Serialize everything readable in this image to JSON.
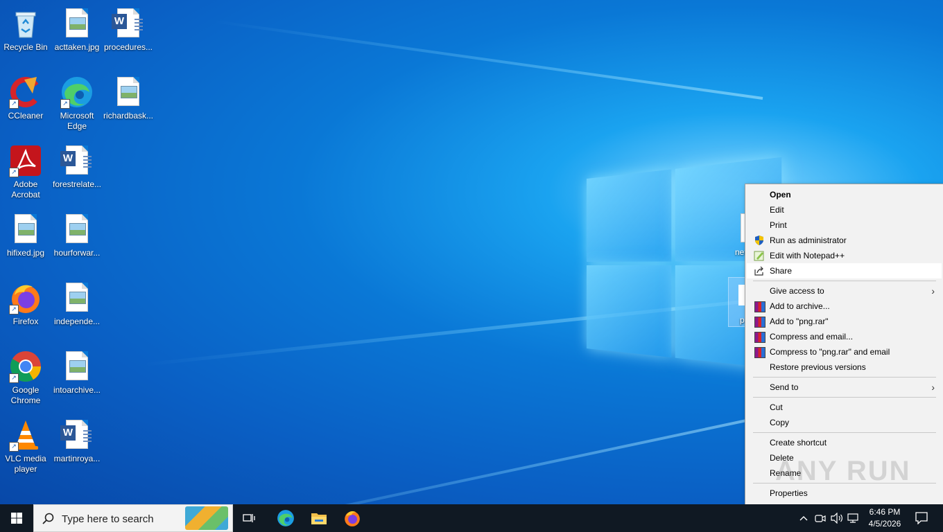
{
  "desktop": {
    "icons": [
      {
        "label": "Recycle Bin",
        "kind": "recycle-bin"
      },
      {
        "label": "acttaken.jpg",
        "kind": "image-file"
      },
      {
        "label": "procedures...",
        "kind": "word-file"
      },
      {
        "label": "CCleaner",
        "kind": "ccleaner"
      },
      {
        "label": "Microsoft Edge",
        "kind": "edge"
      },
      {
        "label": "richardbask...",
        "kind": "image-file"
      },
      {
        "label": "Adobe Acrobat",
        "kind": "acrobat"
      },
      {
        "label": "forestrelate...",
        "kind": "word-file"
      },
      {
        "label": "hifixed.jpg",
        "kind": "image-file"
      },
      {
        "label": "hourforwar...",
        "kind": "image-file"
      },
      {
        "label": "Firefox",
        "kind": "firefox"
      },
      {
        "label": "independe...",
        "kind": "image-file"
      },
      {
        "label": "Google Chrome",
        "kind": "chrome"
      },
      {
        "label": "intoarchive...",
        "kind": "image-file"
      },
      {
        "label": "VLC media player",
        "kind": "vlc"
      },
      {
        "label": "martinroya...",
        "kind": "word-file"
      }
    ],
    "partial_icon_label": "netf",
    "partial_icon2_label": "p"
  },
  "context_menu": {
    "items": [
      {
        "label": "Open",
        "bold": true,
        "icon": ""
      },
      {
        "label": "Edit",
        "icon": ""
      },
      {
        "label": "Print",
        "icon": ""
      },
      {
        "label": "Run as administrator",
        "icon": "shield-icon"
      },
      {
        "label": "Edit with Notepad++",
        "icon": "notepadpp-icon"
      },
      {
        "label": "Share",
        "icon": "share-icon",
        "highlighted": true
      },
      {
        "label": "Give access to",
        "submenu": true
      },
      {
        "label": "Add to archive...",
        "icon": "winrar-icon"
      },
      {
        "label": "Add to \"png.rar\"",
        "icon": "winrar-icon"
      },
      {
        "label": "Compress and email...",
        "icon": "winrar-icon"
      },
      {
        "label": "Compress to \"png.rar\" and email",
        "icon": "winrar-icon"
      },
      {
        "label": "Restore previous versions"
      },
      {
        "label": "Send to",
        "submenu": true
      },
      {
        "label": "Cut"
      },
      {
        "label": "Copy"
      },
      {
        "label": "Create shortcut"
      },
      {
        "label": "Delete"
      },
      {
        "label": "Rename"
      },
      {
        "label": "Properties"
      }
    ]
  },
  "watermark": "ANY RUN",
  "taskbar": {
    "search_placeholder": "Type here to search",
    "time": "6:46 PM",
    "date": "4/5/2026",
    "pinned": [
      "task-view-icon",
      "edge-icon",
      "file-explorer-icon",
      "firefox-icon"
    ]
  }
}
